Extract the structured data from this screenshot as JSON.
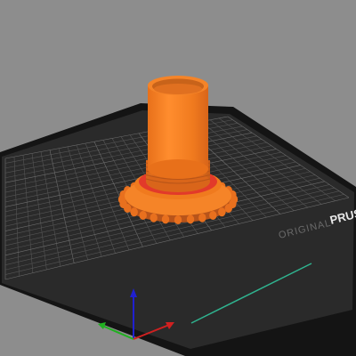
{
  "app": {
    "view": "3d-plater-viewport",
    "background_color": "#8d8d8d"
  },
  "bed": {
    "label_prefix": "ORIGINAL",
    "label_brand": "PRUS",
    "surface_color": "#2a2a2a",
    "edge_color": "#141414",
    "grid_color": "#5a5a5a",
    "label_color": "#6a6a6a",
    "brand_color": "#e8e8e8"
  },
  "model": {
    "color": "#f07a1e",
    "shade_color": "#d9651a",
    "collar_color": "#e23a2a",
    "interior_color": "#c8631a"
  },
  "axes": {
    "x_color": "#d02020",
    "y_color": "#20b020",
    "z_color": "#2020d0"
  }
}
